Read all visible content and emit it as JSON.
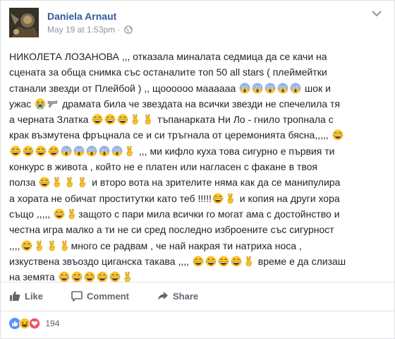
{
  "author": {
    "name": "Daniela Arnaut"
  },
  "post_meta": {
    "timestamp": "May 19 at 1:53pm",
    "separator": "·"
  },
  "post": {
    "lines": [
      [
        "НИКОЛЕТА ЛОЗАНОВА ,,, отказала миналата седмица да се качи на"
      ],
      [
        "сцената за обща снимка със останалите топ 50 all stars ( плеймейтки"
      ],
      [
        "станали звезди от Плейбой ) ,, щоооооо маааааа ",
        "E:scream",
        "E:scream",
        "E:scream",
        "E:scream",
        "E:scream",
        " шок и"
      ],
      [
        "ужас ",
        "E:sob",
        "E:gun",
        " драмата била че звездата на всички звезди не спечелила тя"
      ],
      [
        "а черната Златка ",
        "E:laugh",
        "E:laugh",
        "E:laugh",
        "E:victory",
        "E:victory",
        " тъпанарката Ни Ло - гнило тропнала с"
      ],
      [
        "крак възмутена фръцнала се и си тръгнала от церемонията бясна,,,,, ",
        "E:laugh"
      ],
      [
        "E:laugh",
        "E:laugh",
        "E:laugh",
        "E:laugh",
        "E:scream",
        "E:scream",
        "E:scream",
        "E:scream",
        "E:scream",
        "E:victory",
        " ,,, ми кифло куха това сигурно е първия ти"
      ],
      [
        "конкурс в живота , който не е платен или нагласен с факане в твоя"
      ],
      [
        "полза ",
        "E:laugh",
        "E:victory",
        "E:victory",
        "E:victory",
        " и второ вота на зрителите няма как да се манипулира"
      ],
      [
        "а хората не обичат проститутки като теб !!!!!",
        "E:laugh",
        "E:victory",
        " и копия на други хора"
      ],
      [
        "също ,,,,, ",
        "E:laugh",
        "E:victory",
        "защото с пари мила всички го могат ама с достойнство и"
      ],
      [
        "честна игра малко а ти не си сред последно изброените със сигурност"
      ],
      [
        ",,,,",
        "E:laugh",
        "E:victory",
        "E:victory",
        "E:victory",
        "много се радвам , че най накрая ти натриха носа ,"
      ],
      [
        "изкуствена звъоздо циганска такава ,,,, ",
        "E:laugh",
        "E:laugh",
        "E:laugh",
        "E:laugh",
        "E:victory",
        " време е да слизаш"
      ],
      [
        "на земята ",
        "E:laugh",
        "E:laugh",
        "E:laugh",
        "E:laugh",
        "E:laugh",
        "E:victory"
      ]
    ]
  },
  "actions": {
    "like_label": "Like",
    "comment_label": "Comment",
    "share_label": "Share"
  },
  "reactions": {
    "count": "194",
    "icons": [
      "like-icon",
      "haha-icon",
      "love-icon"
    ]
  },
  "colors": {
    "link": "#365899",
    "meta": "#90949c",
    "text": "#1d2129",
    "action": "#616770",
    "like_blue": "#5890ff",
    "love_red": "#f25268",
    "emoji_yellow": "#fbc62b"
  }
}
